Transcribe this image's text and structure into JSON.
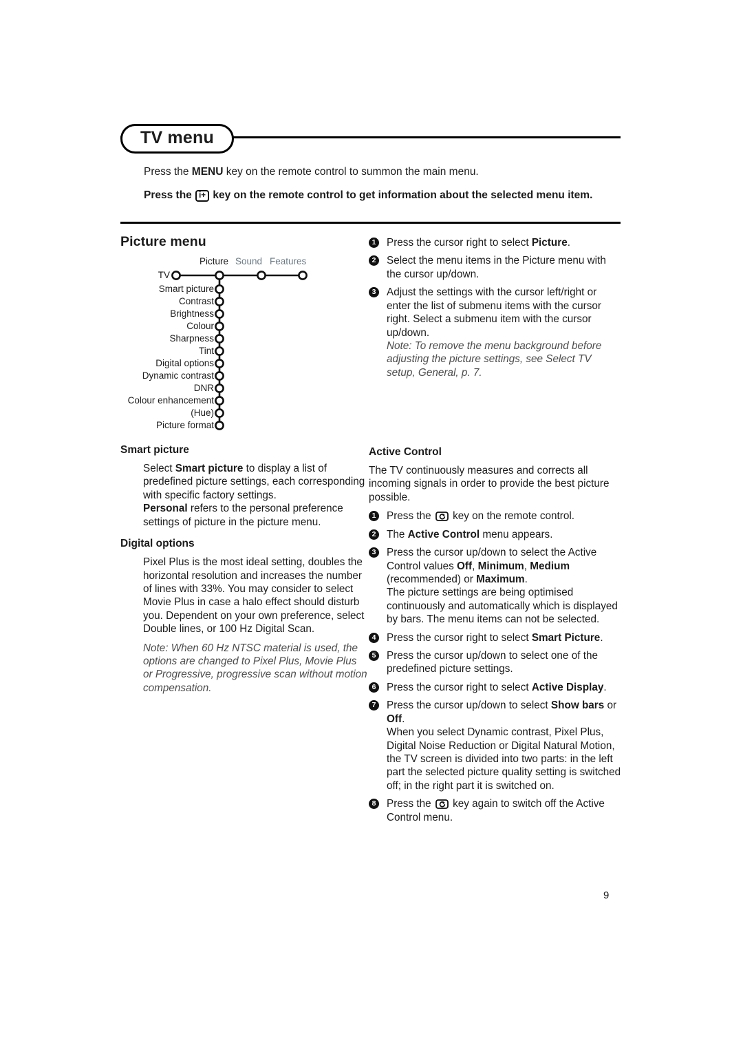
{
  "header": {
    "title": "TV menu",
    "intro_plain_pre": "Press the ",
    "intro_plain_key": "MENU",
    "intro_plain_post": " key on the remote control to summon the main menu.",
    "intro_bold_pre": "Press the ",
    "intro_bold_key": "i+",
    "intro_bold_post": " key on the remote control to get information about the selected menu item."
  },
  "picture_menu": {
    "title": "Picture menu",
    "tabs": [
      {
        "label": "Picture",
        "active": true
      },
      {
        "label": "Sound",
        "active": false
      },
      {
        "label": "Features",
        "active": false
      }
    ],
    "root_label": "TV",
    "items": [
      "Smart picture",
      "Contrast",
      "Brightness",
      "Colour",
      "Sharpness",
      "Tint",
      "Digital options",
      "Dynamic contrast",
      "DNR",
      "Colour enhancement",
      "(Hue)",
      "Picture format"
    ]
  },
  "steps_picture": [
    {
      "num": "1",
      "parts": [
        {
          "t": "Press the cursor right to select ",
          "b": false
        },
        {
          "t": "Picture",
          "b": true
        },
        {
          "t": ".",
          "b": false
        }
      ]
    },
    {
      "num": "2",
      "parts": [
        {
          "t": "Select the menu items in the Picture menu with the cursor up/down.",
          "b": false
        }
      ]
    },
    {
      "num": "3",
      "parts": [
        {
          "t": "Adjust the settings with the cursor left/right or enter the list of submenu items with the cursor right. Select a submenu item with the cursor up/down.",
          "b": false
        }
      ],
      "note": "Note: To remove the menu background before adjusting the picture settings, see Select TV setup, General, p. 7."
    }
  ],
  "smart_picture": {
    "heading": "Smart picture",
    "p1_pre": "Select ",
    "p1_bold": "Smart picture",
    "p1_post": " to display a list of predefined picture settings, each corresponding with specific factory settings.",
    "p2_bold": "Personal",
    "p2_post": " refers to the personal preference settings of picture in the picture menu."
  },
  "digital_options": {
    "heading": "Digital options",
    "p1": "Pixel Plus is the most ideal setting, doubles the horizontal resolution and increases the number of lines with 33%. You may consider to select Movie Plus in case a halo effect should disturb you. Dependent on your own preference, select Double lines, or 100 Hz Digital Scan.",
    "note": "Note: When 60 Hz NTSC material is used, the options are changed to Pixel Plus, Movie Plus or Progressive, progressive scan without motion compensation."
  },
  "active_control": {
    "heading": "Active Control",
    "intro": "The TV continuously measures and corrects all incoming signals in order to provide the best picture possible.",
    "steps": [
      {
        "num": "1",
        "parts": [
          {
            "t": "Press the ",
            "b": false
          },
          {
            "icon": "active-control-key"
          },
          {
            "t": " key on the remote control.",
            "b": false
          }
        ]
      },
      {
        "num": "2",
        "parts": [
          {
            "t": "The ",
            "b": false
          },
          {
            "t": "Active Control",
            "b": true
          },
          {
            "t": " menu appears.",
            "b": false
          }
        ]
      },
      {
        "num": "3",
        "parts": [
          {
            "t": "Press the cursor up/down to select the Active Control values ",
            "b": false
          },
          {
            "t": "Off",
            "b": true
          },
          {
            "t": ", ",
            "b": false
          },
          {
            "t": "Minimum",
            "b": true
          },
          {
            "t": ", ",
            "b": false
          },
          {
            "t": "Medium",
            "b": true
          },
          {
            "t": " (recommended) or ",
            "b": false
          },
          {
            "t": "Maximum",
            "b": true
          },
          {
            "t": ".",
            "b": false
          }
        ],
        "extra": "The picture settings are being optimised continuously and automatically which is displayed by bars. The menu items can not be selected."
      },
      {
        "num": "4",
        "parts": [
          {
            "t": "Press the cursor right to select ",
            "b": false
          },
          {
            "t": "Smart Picture",
            "b": true
          },
          {
            "t": ".",
            "b": false
          }
        ]
      },
      {
        "num": "5",
        "parts": [
          {
            "t": "Press the cursor up/down to select one of the predefined picture settings.",
            "b": false
          }
        ]
      },
      {
        "num": "6",
        "parts": [
          {
            "t": "Press the cursor right to select ",
            "b": false
          },
          {
            "t": "Active Display",
            "b": true
          },
          {
            "t": ".",
            "b": false
          }
        ]
      },
      {
        "num": "7",
        "parts": [
          {
            "t": "Press the cursor up/down to select ",
            "b": false
          },
          {
            "t": "Show bars",
            "b": true
          },
          {
            "t": " or ",
            "b": false
          },
          {
            "t": "Off",
            "b": true
          },
          {
            "t": ".",
            "b": false
          }
        ],
        "extra": "When you select Dynamic contrast, Pixel Plus, Digital Noise Reduction or Digital Natural Motion, the TV screen is divided into two parts: in the left part the selected picture quality setting is switched off; in the right part it is switched on."
      },
      {
        "num": "8",
        "parts": [
          {
            "t": "Press the ",
            "b": false
          },
          {
            "icon": "active-control-key"
          },
          {
            "t": " key again to switch off the Active Control menu.",
            "b": false
          }
        ]
      }
    ]
  },
  "page_number": "9",
  "colors": {
    "text": "#1b1b1b",
    "muted_tab": "#6b7a85",
    "note": "#4c4c4c",
    "rule": "#000000"
  }
}
